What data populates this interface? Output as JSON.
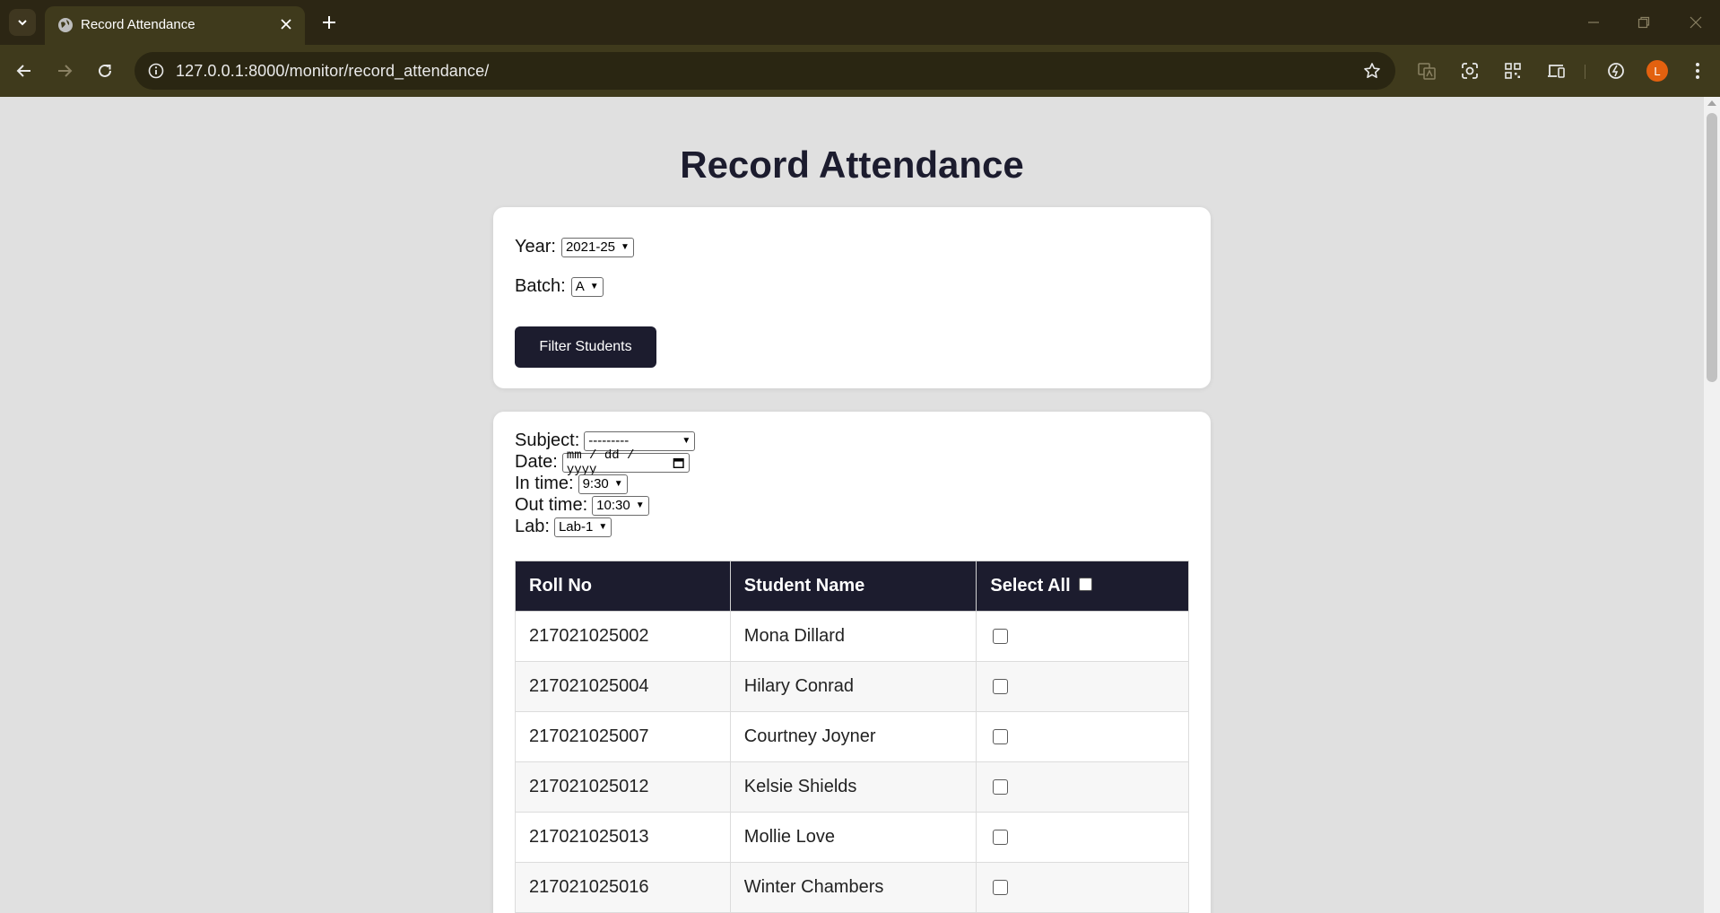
{
  "browser": {
    "tab_title": "Record Attendance",
    "url": "127.0.0.1:8000/monitor/record_attendance/",
    "profile_initial": "L"
  },
  "page": {
    "title": "Record Attendance"
  },
  "filter": {
    "year_label": "Year:",
    "year_value": "2021-25",
    "batch_label": "Batch:",
    "batch_value": "A",
    "button_label": "Filter Students"
  },
  "attendance": {
    "subject_label": "Subject:",
    "subject_value": "---------",
    "date_label": "Date:",
    "date_placeholder": "mm / dd / yyyy",
    "in_time_label": "In time:",
    "in_time_value": "9:30",
    "out_time_label": "Out time:",
    "out_time_value": "10:30",
    "lab_label": "Lab:",
    "lab_value": "Lab-1"
  },
  "table": {
    "headers": [
      "Roll No",
      "Student Name",
      "Select All"
    ],
    "rows": [
      {
        "roll": "217021025002",
        "name": "Mona Dillard"
      },
      {
        "roll": "217021025004",
        "name": "Hilary Conrad"
      },
      {
        "roll": "217021025007",
        "name": "Courtney Joyner"
      },
      {
        "roll": "217021025012",
        "name": "Kelsie Shields"
      },
      {
        "roll": "217021025013",
        "name": "Mollie Love"
      },
      {
        "roll": "217021025016",
        "name": "Winter Chambers"
      }
    ]
  },
  "colors": {
    "header_dark": "#1c1c2e",
    "page_bg": "#e0e0e0",
    "chrome_bg": "#3f3a1c",
    "avatar": "#e3610f"
  }
}
